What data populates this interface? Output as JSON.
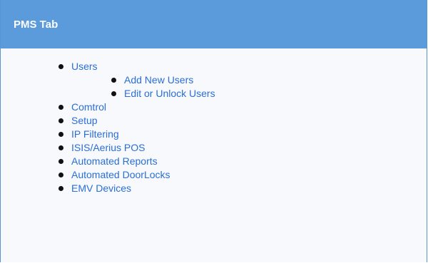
{
  "panel": {
    "title": "PMS Tab"
  },
  "toc": {
    "users": "Users",
    "users_children": [
      "Add New Users",
      "Edit or Unlock Users"
    ],
    "items": [
      "Comtrol",
      "Setup",
      "IP Filtering",
      "ISIS/Aerius POS",
      "Automated Reports",
      "Automated DoorLocks",
      "EMV Devices"
    ]
  }
}
